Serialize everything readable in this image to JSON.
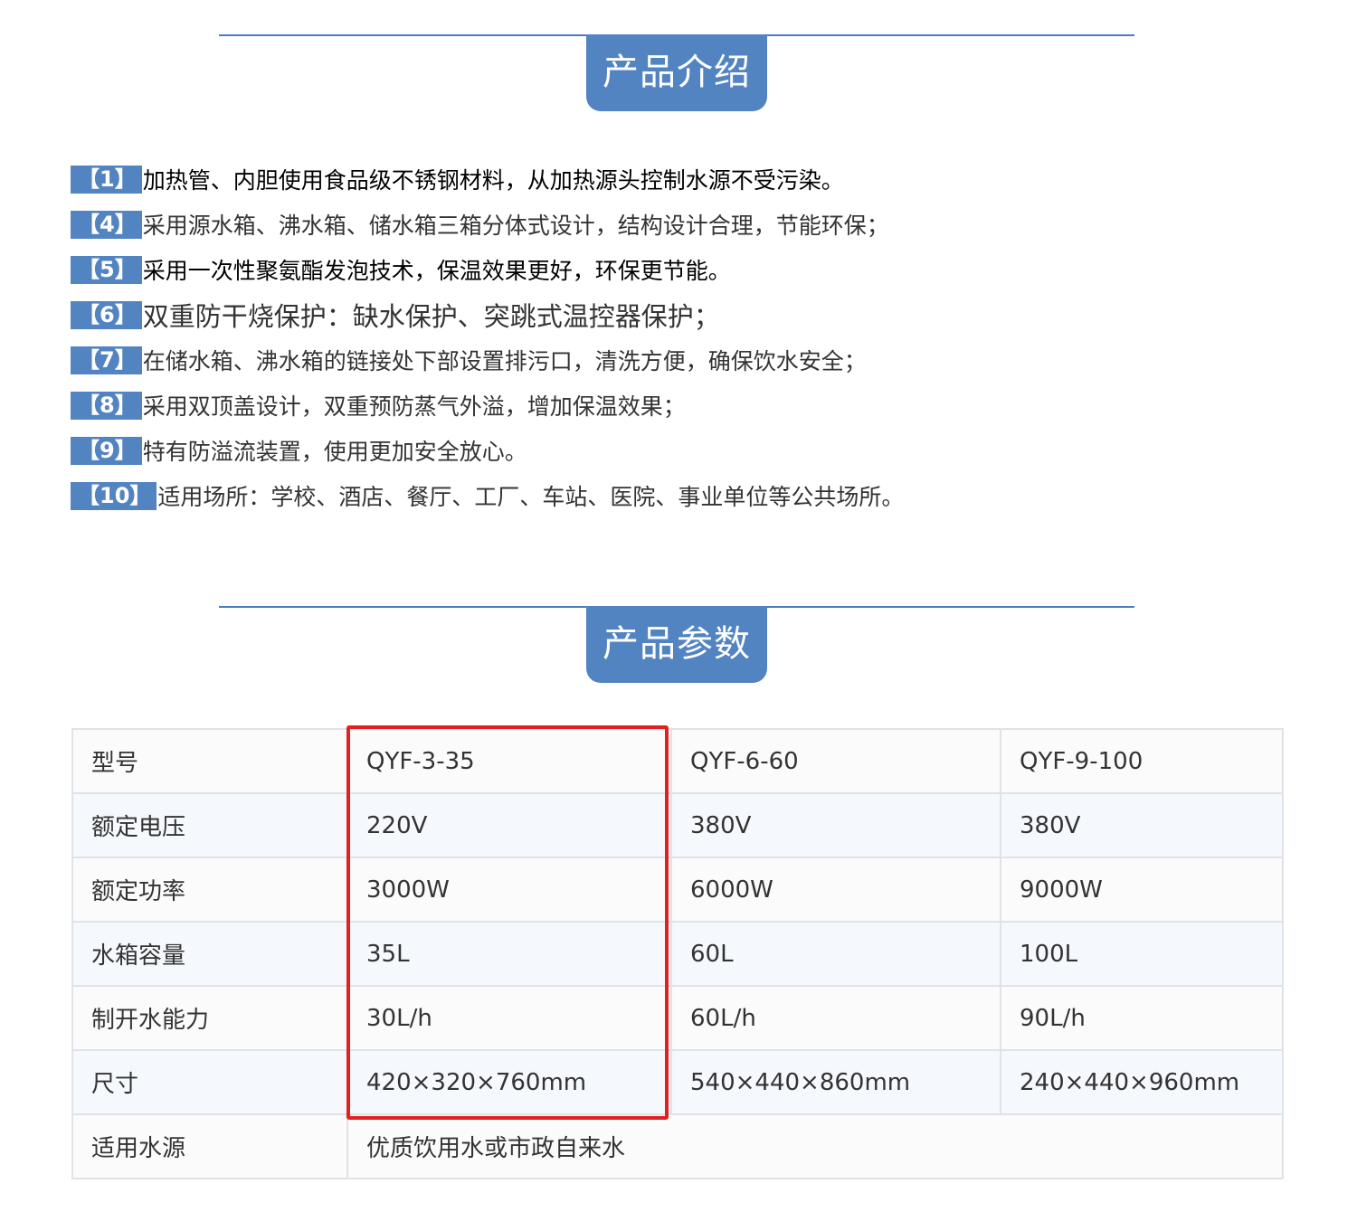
{
  "intro": {
    "title": "产品介绍",
    "features": [
      {
        "num": "【1】",
        "text": "加热管、内胆使用食品级不锈钢材料，从加热源头控制水源不受污染。"
      },
      {
        "num": "【4】",
        "text": "采用源水箱、沸水箱、储水箱三箱分体式设计，结构设计合理，节能环保；"
      },
      {
        "num": "【5】",
        "text": "采用一次性聚氨酯发泡技术，保温效果更好，环保更节能。"
      },
      {
        "num": "【6】",
        "text": "双重防干烧保护：缺水保护、突跳式温控器保护；"
      },
      {
        "num": "【7】",
        "text": "在储水箱、沸水箱的链接处下部设置排污口，清洗方便，确保饮水安全；"
      },
      {
        "num": "【8】",
        "text": "采用双顶盖设计，双重预防蒸气外溢，增加保温效果；"
      },
      {
        "num": "【9】",
        "text": "特有防溢流装置，使用更加安全放心。"
      },
      {
        "num": "【10】",
        "text": "适用场所：学校、酒店、餐厅、工厂、车站、医院、事业单位等公共场所。"
      }
    ]
  },
  "params": {
    "title": "产品参数",
    "rows": [
      {
        "label": "型号",
        "a": "QYF-3-35",
        "b": "QYF-6-60",
        "c": "QYF-9-100"
      },
      {
        "label": "额定电压",
        "a": "220V",
        "b": "380V",
        "c": "380V"
      },
      {
        "label": "额定功率",
        "a": "3000W",
        "b": "6000W",
        "c": "9000W"
      },
      {
        "label": "水箱容量",
        "a": "35L",
        "b": "60L",
        "c": "100L"
      },
      {
        "label": "制开水能力",
        "a": "30L/h",
        "b": "60L/h",
        "c": "90L/h"
      },
      {
        "label": "尺寸",
        "a": "420×320×760mm",
        "b": "540×440×860mm",
        "c": "240×440×960mm"
      }
    ],
    "water_source": {
      "label": "适用水源",
      "value": "优质饮用水或市政自来水"
    }
  },
  "colors": {
    "accent": "#5384c2",
    "rule": "#4a7ebf",
    "highlight": "#e32020",
    "table_border": "#dfe3e8"
  }
}
